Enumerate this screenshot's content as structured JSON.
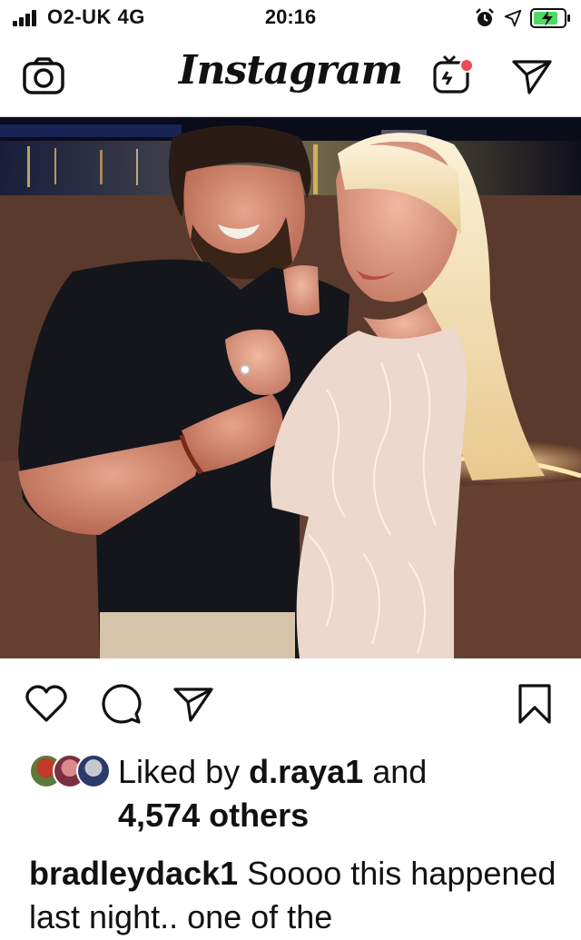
{
  "status_bar": {
    "carrier": "O2-UK 4G",
    "time": "20:16"
  },
  "nav": {
    "logo": "Instagram",
    "icons": [
      "camera-icon",
      "igtv-icon",
      "direct-message-icon"
    ],
    "igtv_dot_color": "#ed4956"
  },
  "post": {
    "photo_icon": "couple-photo",
    "actions": [
      "heart-icon",
      "comment-icon",
      "share-icon",
      "bookmark-icon"
    ],
    "likes": {
      "prefix": "Liked by",
      "user": "d.raya1",
      "conjunction": "and",
      "others": "4,574 others"
    },
    "caption": {
      "username": "bradleydack1",
      "text": "Soooo this happened last night.. one of the"
    }
  }
}
